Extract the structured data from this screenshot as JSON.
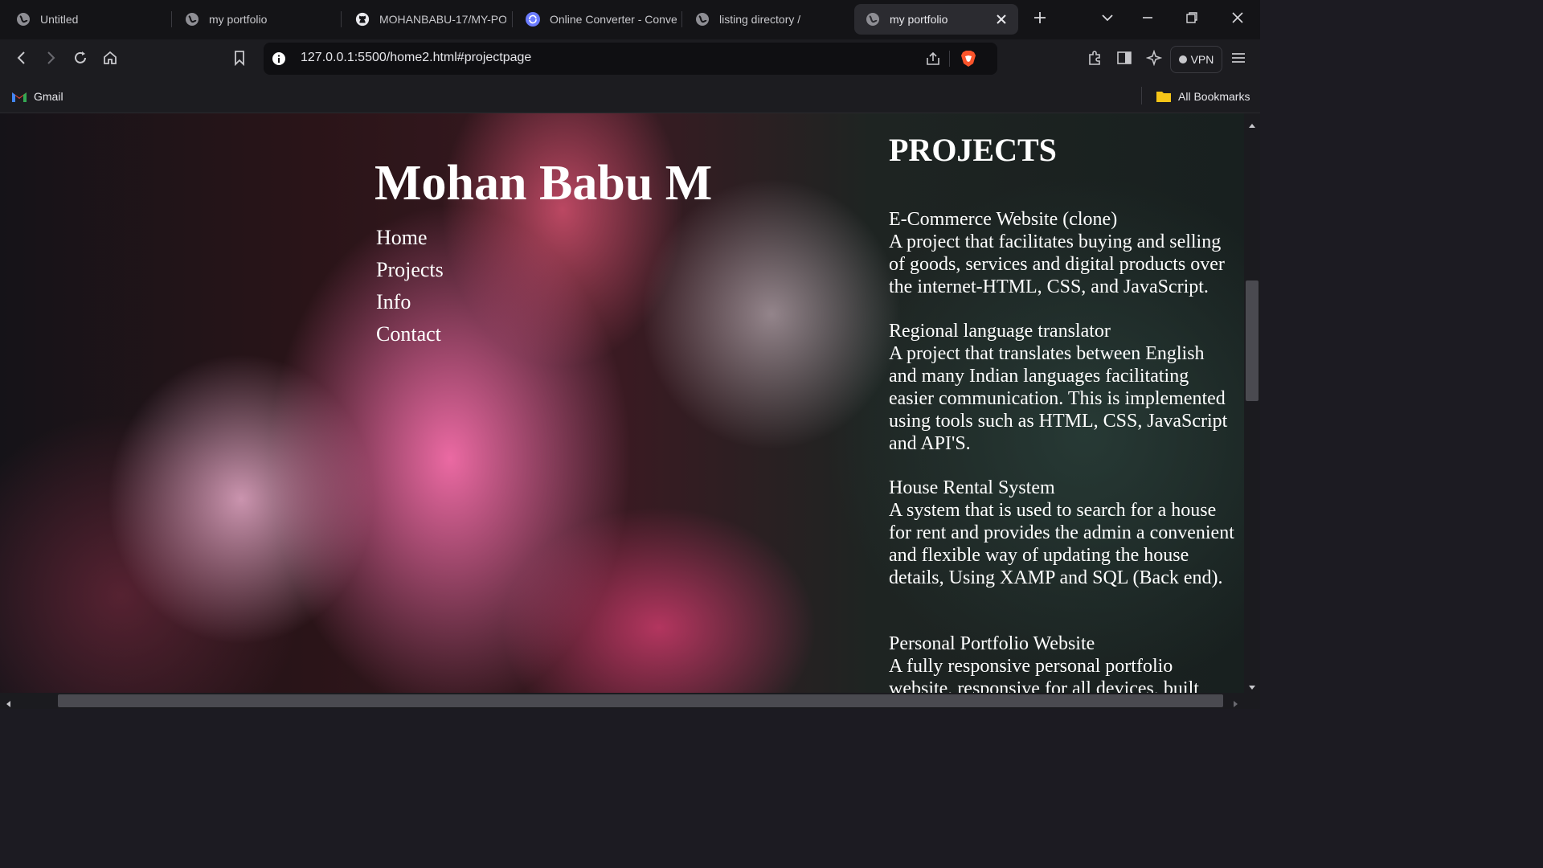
{
  "browser": {
    "tabs": [
      {
        "title": "Untitled",
        "icon": "globe-icon"
      },
      {
        "title": "my portfolio",
        "icon": "globe-icon"
      },
      {
        "title": "MOHANBABU-17/MY-PO",
        "icon": "github-icon"
      },
      {
        "title": "Online Converter - Conve",
        "icon": "converter-icon"
      },
      {
        "title": "listing directory /",
        "icon": "globe-icon"
      },
      {
        "title": "my portfolio",
        "icon": "globe-icon",
        "active": true
      }
    ],
    "url": "127.0.0.1:5500/home2.html#projectpage",
    "vpn_label": "VPN",
    "bookmarks": {
      "gmail": "Gmail",
      "all_bookmarks": "All Bookmarks"
    }
  },
  "page": {
    "site_title": "Mohan Babu M",
    "nav": [
      "Home",
      "Projects",
      "Info",
      "Contact"
    ],
    "projects_heading": "PROJECTS",
    "projects": [
      {
        "title": "E-Commerce Website (clone)",
        "description": "A project that facilitates buying and selling of goods, services and digital products over the internet-HTML, CSS, and JavaScript."
      },
      {
        "title": "Regional language translator",
        "description": "A project that translates between English and many Indian languages facilitating easier communication. This is implemented using tools such as HTML, CSS, JavaScript and API'S."
      },
      {
        "title": "House Rental System",
        "description": "A system that is used to search for a house for rent and provides the admin a convenient and flexible way of updating the house details, Using XAMP and SQL (Back end)."
      },
      {
        "title": "Personal Portfolio Website",
        "description": "A fully responsive personal portfolio website, responsive for all devices, built"
      }
    ]
  },
  "colors": {
    "brave_accent": "#fb542b",
    "chrome_bg": "#1c1c20"
  }
}
